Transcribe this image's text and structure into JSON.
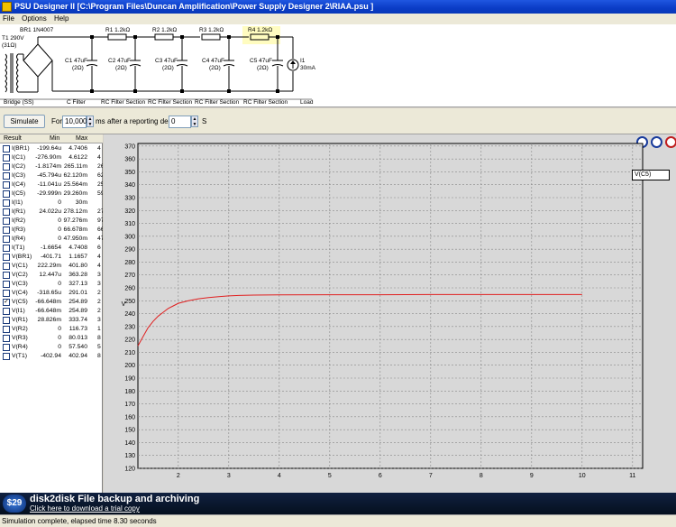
{
  "window": {
    "title": "PSU Designer II  [C:\\Program Files\\Duncan Amplification\\Power Supply Designer 2\\RIAA.psu ]"
  },
  "menu": [
    "File",
    "Options",
    "Help"
  ],
  "schematic": {
    "transformer": [
      "T1 290V",
      "(31Ω)"
    ],
    "bridge_label": "BR1 1N4007",
    "resistors": [
      "R1 1.2kΩ",
      "R2 1.2kΩ",
      "R3 1.2kΩ",
      "R4 1.2kΩ"
    ],
    "capacitors": [
      [
        "C1 47uF",
        "(2Ω)"
      ],
      [
        "C2 47uF",
        "(2Ω)"
      ],
      [
        "C3 47uF",
        "(2Ω)"
      ],
      [
        "C4 47uF",
        "(2Ω)"
      ],
      [
        "C5 47uF",
        "(2Ω)"
      ]
    ],
    "load": [
      "I1",
      "30mA"
    ],
    "sections": [
      "Bridge (SS)",
      "C Filter",
      "RC Filter Section",
      "RC Filter Section",
      "RC Filter Section",
      "RC Filter Section",
      "Load"
    ],
    "highlight_color": "#fffcc0"
  },
  "toolbar": {
    "simulate": "Simulate",
    "for_label": "For",
    "duration": "10,000",
    "ms_label": "ms",
    "delay_label": "after a reporting delay of",
    "delay": "0",
    "s_label": "S"
  },
  "results": {
    "headers": [
      "Result",
      "Min",
      "Max"
    ],
    "rows": [
      {
        "name": "I(BR1)",
        "min": "-199.64u",
        "max": "4.7406",
        "extra": "4",
        "checked": false
      },
      {
        "name": "I(C1)",
        "min": "-276.90m",
        "max": "4.6122",
        "extra": "4",
        "checked": false
      },
      {
        "name": "I(C2)",
        "min": "-1.8174m",
        "max": "265.11m",
        "extra": "26",
        "checked": false
      },
      {
        "name": "I(C3)",
        "min": "-45.794u",
        "max": "62.120m",
        "extra": "62.",
        "checked": false
      },
      {
        "name": "I(C4)",
        "min": "-11.041u",
        "max": "25.564m",
        "extra": "25.",
        "checked": false
      },
      {
        "name": "I(C5)",
        "min": "-29.999n",
        "max": "29.260m",
        "extra": "59.",
        "checked": false
      },
      {
        "name": "I(I1)",
        "min": "0",
        "max": "30m",
        "extra": "",
        "checked": false
      },
      {
        "name": "I(R1)",
        "min": "24.022u",
        "max": "278.12m",
        "extra": "27",
        "checked": false
      },
      {
        "name": "I(R2)",
        "min": "0",
        "max": "97.276m",
        "extra": "97.",
        "checked": false
      },
      {
        "name": "I(R3)",
        "min": "0",
        "max": "66.678m",
        "extra": "66.",
        "checked": false
      },
      {
        "name": "I(R4)",
        "min": "0",
        "max": "47.950m",
        "extra": "47.",
        "checked": false
      },
      {
        "name": "I(T1)",
        "min": "-1.6654",
        "max": "4.7408",
        "extra": "6",
        "checked": false
      },
      {
        "name": "V(BR1)",
        "min": "-401.71",
        "max": "1.1657",
        "extra": "4",
        "checked": false
      },
      {
        "name": "V(C1)",
        "min": "222.29m",
        "max": "401.80",
        "extra": "4",
        "checked": false
      },
      {
        "name": "V(C2)",
        "min": "12.447u",
        "max": "363.28",
        "extra": "3",
        "checked": false
      },
      {
        "name": "V(C3)",
        "min": "0",
        "max": "327.13",
        "extra": "3",
        "checked": false
      },
      {
        "name": "V(C4)",
        "min": "-318.65u",
        "max": "291.01",
        "extra": "2",
        "checked": false
      },
      {
        "name": "V(C5)",
        "min": "-66.648m",
        "max": "254.89",
        "extra": "2",
        "checked": true
      },
      {
        "name": "V(I1)",
        "min": "-66.648m",
        "max": "254.89",
        "extra": "2",
        "checked": false
      },
      {
        "name": "V(R1)",
        "min": "28.826m",
        "max": "333.74",
        "extra": "3",
        "checked": false
      },
      {
        "name": "V(R2)",
        "min": "0",
        "max": "116.73",
        "extra": "1",
        "checked": false
      },
      {
        "name": "V(R3)",
        "min": "0",
        "max": "80.013",
        "extra": "8",
        "checked": false
      },
      {
        "name": "V(R4)",
        "min": "0",
        "max": "57.540",
        "extra": "5",
        "checked": false
      },
      {
        "name": "V(T1)",
        "min": "-402.94",
        "max": "402.94",
        "extra": "8",
        "checked": false
      }
    ]
  },
  "chart_data": {
    "type": "line",
    "ylabel": "V",
    "xlim": [
      1.2,
      11.2
    ],
    "ylim": [
      120,
      372
    ],
    "xticks": [
      2,
      3,
      4,
      5,
      6,
      7,
      8,
      9,
      10,
      11
    ],
    "yticks": [
      120,
      130,
      140,
      150,
      160,
      170,
      180,
      190,
      200,
      210,
      220,
      230,
      240,
      250,
      260,
      270,
      280,
      290,
      300,
      310,
      320,
      330,
      340,
      350,
      360,
      370
    ],
    "grid": true,
    "legend_position": "top-right",
    "series": [
      {
        "name": "V(C5)",
        "color": "#e02020",
        "x": [
          1.2,
          1.3,
          1.4,
          1.5,
          1.6,
          1.7,
          1.8,
          1.9,
          2.0,
          2.2,
          2.4,
          2.6,
          2.8,
          3.0,
          3.2,
          3.5,
          4.0,
          5.0,
          6.0,
          7.0,
          8.0,
          9.0,
          10.0
        ],
        "y": [
          215,
          222,
          229,
          234,
          238,
          241,
          244,
          246,
          248,
          250,
          251.5,
          252.5,
          253.2,
          253.8,
          254.1,
          254.4,
          254.6,
          254.7,
          254.7,
          254.8,
          254.8,
          254.8,
          254.8
        ]
      }
    ]
  },
  "banner": {
    "badge": "$29",
    "title": "disk2disk File backup and archiving",
    "link": "Click here to download a trial copy"
  },
  "status": "Simulation complete, elapsed time 8.30 seconds"
}
